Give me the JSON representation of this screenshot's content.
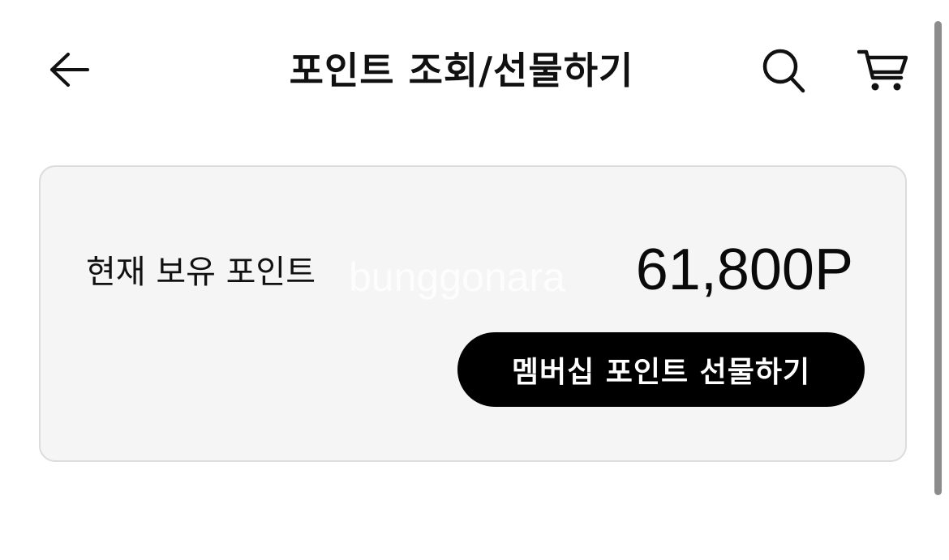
{
  "header": {
    "title": "포인트 조회/선물하기",
    "back_icon": "arrow-left-icon",
    "search_icon": "search-icon",
    "cart_icon": "cart-icon"
  },
  "point_card": {
    "label": "현재 보유 포인트",
    "value": "61,800P",
    "gift_button_label": "멤버십 포인트 선물하기",
    "watermark": "bunggonara"
  },
  "colors": {
    "background": "#ffffff",
    "card_background": "#f5f5f5",
    "card_border": "#dcdcdc",
    "button_background": "#000000",
    "button_text": "#ffffff",
    "text": "#111111"
  }
}
